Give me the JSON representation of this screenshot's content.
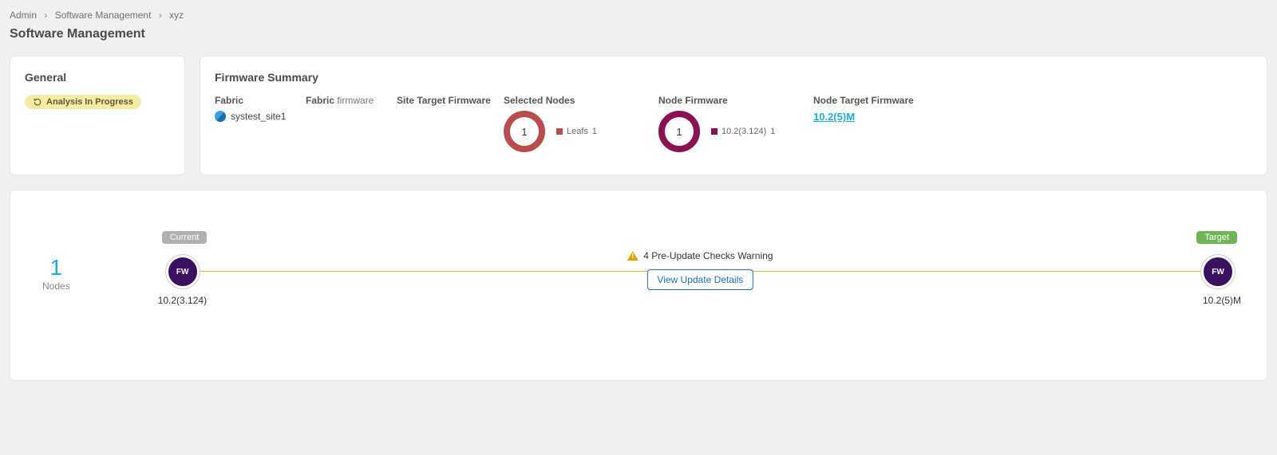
{
  "breadcrumb": [
    "Admin",
    "Software Management",
    "xyz"
  ],
  "page_title": "Software Management",
  "general": {
    "title": "General",
    "status": "Analysis In Progress"
  },
  "summary": {
    "title": "Firmware Summary",
    "fabric_label": "Fabric",
    "fabric_name": "systest_site1",
    "fabric_fw_label_bold": "Fabric",
    "fabric_fw_label_rest": " firmware",
    "site_target_label": "Site Target Firmware",
    "selected_nodes": {
      "label": "Selected Nodes",
      "value": "1",
      "legend_label": "Leafs",
      "legend_count": "1"
    },
    "node_firmware": {
      "label": "Node Firmware",
      "value": "1",
      "legend_label": "10.2(3.124)",
      "legend_count": "1"
    },
    "node_target_fw": {
      "label": "Node Target Firmware",
      "link": "10.2(5)M"
    }
  },
  "timeline": {
    "node_count": "1",
    "node_count_label": "Nodes",
    "fw_badge": "FW",
    "current_tag": "Current",
    "target_tag": "Target",
    "current_version": "10.2(3.124)",
    "target_version": "10.2(5)M",
    "warning_text": "4 Pre-Update Checks Warning",
    "view_button": "View Update Details"
  }
}
